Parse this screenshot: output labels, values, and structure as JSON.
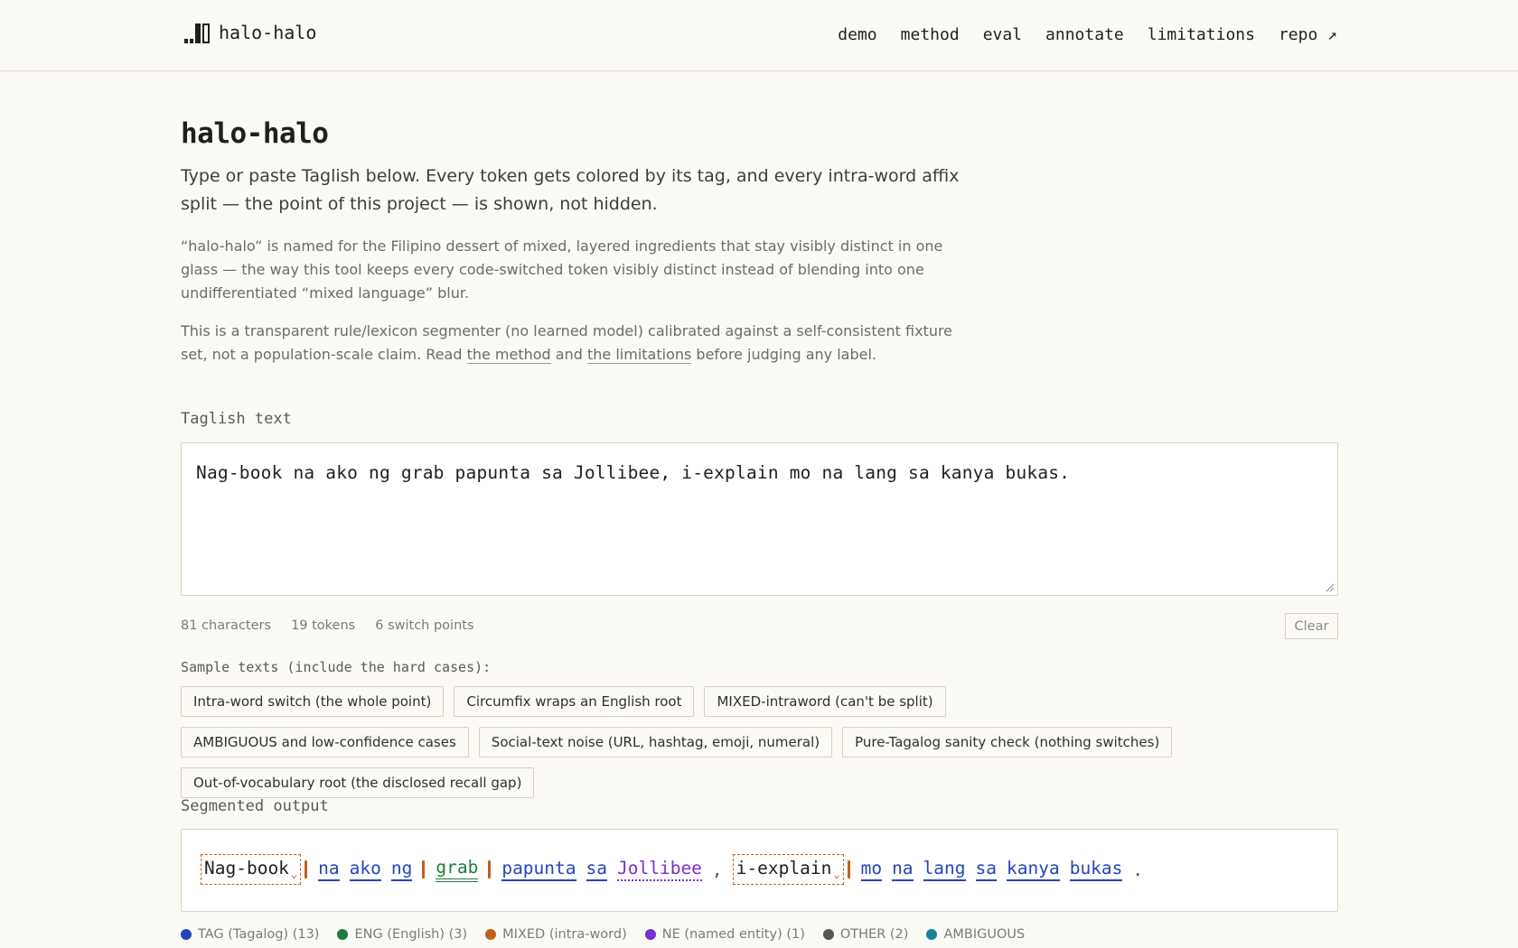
{
  "header": {
    "brand": "halo-halo",
    "nav": [
      "demo",
      "method",
      "eval",
      "annotate",
      "limitations",
      "repo ↗"
    ]
  },
  "main": {
    "title": "halo-halo",
    "lead": "Type or paste Taglish below. Every token gets colored by its tag, and every intra-word affix split — the point of this project — is shown, not hidden.",
    "about": "“halo-halo” is named for the Filipino dessert of mixed, layered ingredients that stay visibly distinct in one glass — the way this tool keeps every code-switched token visibly distinct instead of blending into one undifferentiated “mixed language” blur.",
    "disclaimer_pre": "This is a transparent rule/lexicon segmenter (no learned model) calibrated against a self-consistent fixture set, not a population-scale claim. Read ",
    "disclaimer_link1": "the method",
    "disclaimer_mid": " and ",
    "disclaimer_link2": "the limitations",
    "disclaimer_post": " before judging any label."
  },
  "input": {
    "label": "Taglish text",
    "value": "Nag-book na ako ng grab papunta sa Jollibee, i-explain mo na lang sa kanya bukas."
  },
  "stats": {
    "characters": "81 characters",
    "tokens": "19 tokens",
    "switch_points": "6 switch points",
    "clear_label": "Clear"
  },
  "samples": {
    "label": "Sample texts (include the hard cases):",
    "items": [
      "Intra-word switch (the whole point)",
      "Circumfix wraps an English root",
      "MIXED-intraword (can't be split)",
      "AMBIGUOUS and low-confidence cases",
      "Social-text noise (URL, hashtag, emoji, numeral)",
      "Pure-Tagalog sanity check (nothing switches)",
      "Out-of-vocabulary root (the disclosed recall gap)"
    ]
  },
  "output": {
    "label": "Segmented output",
    "tokens": [
      {
        "text": "Nag-book",
        "tag": "mixed"
      },
      {
        "text": "na",
        "tag": "tag"
      },
      {
        "text": "ako",
        "tag": "tag"
      },
      {
        "text": "ng",
        "tag": "tag"
      },
      {
        "text": "grab",
        "tag": "eng"
      },
      {
        "text": "papunta",
        "tag": "tag"
      },
      {
        "text": "sa",
        "tag": "tag"
      },
      {
        "text": "Jollibee",
        "tag": "ne"
      },
      {
        "text": ",",
        "tag": "oth"
      },
      {
        "text": "i-explain",
        "tag": "mixed"
      },
      {
        "text": "mo",
        "tag": "tag"
      },
      {
        "text": "na",
        "tag": "tag"
      },
      {
        "text": "lang",
        "tag": "tag"
      },
      {
        "text": "sa",
        "tag": "tag"
      },
      {
        "text": "kanya",
        "tag": "tag"
      },
      {
        "text": "bukas",
        "tag": "tag"
      },
      {
        "text": ".",
        "tag": "oth"
      }
    ]
  },
  "legend": [
    {
      "label": "TAG (Tagalog) (13)",
      "color": "#2446b8"
    },
    {
      "label": "ENG (English) (3)",
      "color": "#1f7a3f"
    },
    {
      "label": "MIXED (intra-word)",
      "color": "#c0601a"
    },
    {
      "label": "NE (named entity) (1)",
      "color": "#7a2fd0"
    },
    {
      "label": "OTHER (2)",
      "color": "#555555"
    },
    {
      "label": "AMBIGUOUS",
      "color": "#17809a"
    }
  ]
}
